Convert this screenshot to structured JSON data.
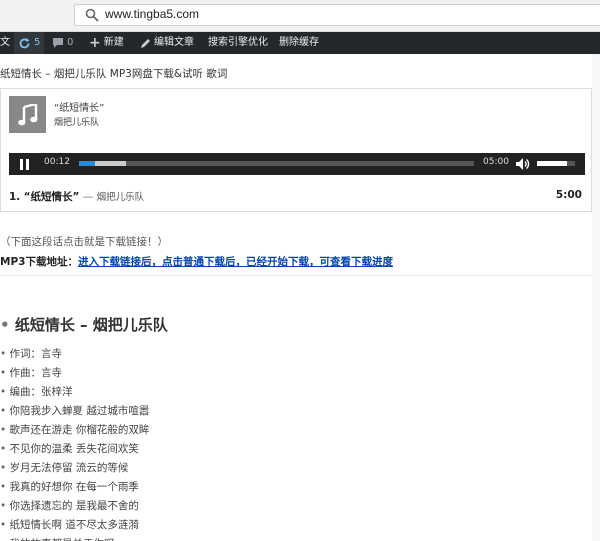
{
  "browser": {
    "url": "www.tingba5.com"
  },
  "adminbar": {
    "cut_item": "文",
    "updates_count": "5",
    "comments_count": "0",
    "new_label": "新建",
    "edit_label": "编辑文章",
    "seo_label": "搜索引擎优化",
    "cache_label": "删除缓存"
  },
  "page": {
    "title": "纸短情长 – 烟把儿乐队 MP3网盘下载&试听 歌词",
    "hint": "（下面这段话点击就是下载链接！）",
    "download_label": "MP3下载地址：",
    "download_link": "进入下载链接后，点击普通下载后，已经开始下载，可查看下载进度",
    "heading": "纸短情长 – 烟把儿乐队"
  },
  "player": {
    "track_title": "“纸短情长”",
    "track_artist": "烟把儿乐队",
    "current_time": "00:12",
    "duration": "05:00",
    "played_fraction": 0.04,
    "buffered_fraction": 0.12,
    "volume_fraction": 0.8,
    "playlist": [
      {
        "num": "1.",
        "title": "“纸短情长”",
        "sep": " — ",
        "artist": "烟把儿乐队",
        "length": "5:00"
      }
    ]
  },
  "lyrics": [
    "作词：言寺",
    "作曲：言寺",
    "编曲：张梓洋",
    "你陪我步入蝉夏 越过城市喧嚣",
    "歌声还在游走 你榴花般的双眸",
    "不见你的温柔 丢失花间欢笑",
    "岁月无法停留 流云的等候",
    "我真的好想你 在每一个雨季",
    "你选择遗忘的 是我最不舍的",
    "纸短情长啊 道不尽太多涟漪",
    "我的故事都是关于你呀"
  ]
}
